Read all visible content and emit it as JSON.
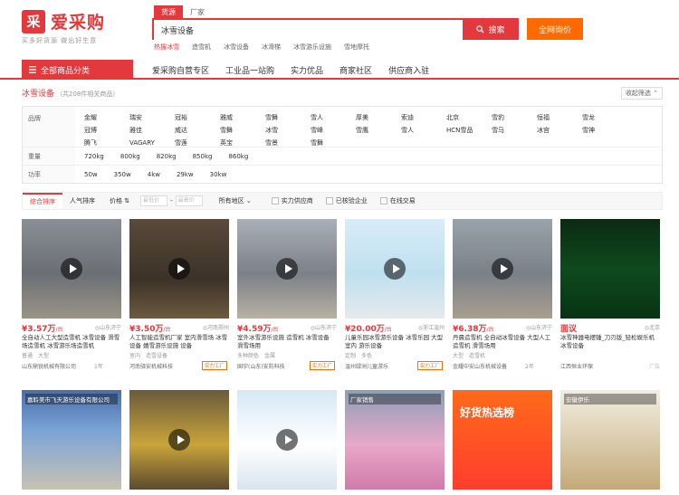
{
  "header": {
    "logo_glyph": "采",
    "logo_text": "爱采购",
    "slogan": "买多好货源  做出好生意",
    "search_tabs": [
      "货源",
      "厂家"
    ],
    "search_value": "冰雪设备",
    "search_button": "搜索",
    "inquiry_button": "全网询价",
    "hot_label": "热搜冰雪",
    "hot_terms": [
      "造雪机",
      "冰雪设备",
      "冰滑梯",
      "冰雪游乐设施",
      "雪地摩托"
    ]
  },
  "nav": {
    "all_categories": "全部商品分类",
    "links": [
      "爱采购自营专区",
      "工业品一站购",
      "实力优品",
      "商家社区",
      "供应商入驻"
    ]
  },
  "breadcrumb": {
    "keyword": "冰雪设备",
    "count_text": "（共208件相关商品）"
  },
  "collapse_label": "收起筛选",
  "filters": {
    "brand_label": "品牌",
    "brands_row1": [
      "金耀",
      "瑞安",
      "冠裕",
      "雅威",
      "雪舞",
      "雪人",
      "厚美",
      "索迪",
      "北京",
      "雪豹"
    ],
    "brands_row2": [
      "恒福",
      "雪龙",
      "冠博",
      "雅佳",
      "威达",
      "雪舞",
      "冰雪",
      "雪峰",
      "雪鹰",
      "雪人"
    ],
    "brands_row3": [
      "HCN雪品",
      "雪马",
      "冰宫",
      "雪神",
      "腾飞",
      "VAGARY",
      "雪莲",
      "英宝",
      "雪景",
      "雪舞"
    ],
    "weight_label": "重量",
    "weights": [
      "720kg",
      "800kg",
      "820kg",
      "850kg",
      "860kg"
    ],
    "power_label": "功率",
    "powers": [
      "50w",
      "350w",
      "4kw",
      "29kw",
      "30kw"
    ]
  },
  "sort": {
    "items": [
      "综合排序",
      "人气排序",
      "价格"
    ],
    "price_from": "最低价",
    "price_to": "最高价",
    "region": "所有地区",
    "checks": [
      "实力供应商",
      "已核验企业",
      "在线交易"
    ]
  },
  "products": [
    {
      "price": "¥3.57万",
      "unit": "/台",
      "loc": "山东济宁",
      "title": "全自动人工大型造雪机 冰雪设备 滑雪场造雪机 冰雪游乐场造雪机",
      "tags": [
        "普通",
        "大型"
      ],
      "company": "山东鼎锐机械有限公司",
      "badge": "",
      "year": "1年"
    },
    {
      "price": "¥3.50万",
      "unit": "/台",
      "loc": "河南郑州",
      "title": "人工智能造雪机厂家 室内滑雪场 冰雪设备 嬉雪游乐设施 设备",
      "tags": [
        "室内",
        "造雪设备"
      ],
      "company": "河南驿安机械科技",
      "badge": "实力工厂",
      "year": ""
    },
    {
      "price": "¥4.59万",
      "unit": "/台",
      "loc": "山东济宁",
      "title": "室外冰雪游乐设施 造雪机 冰雪设备 滑雪场用",
      "tags": [
        "多种颜色",
        "金属"
      ],
      "company": "国宇(山东)安防科技",
      "badge": "实力工厂",
      "year": ""
    },
    {
      "price": "¥20.00万",
      "unit": "/台",
      "loc": "浙江温州",
      "title": "儿童乐园冰雪游乐设备 冰雪乐园 大型室内 游乐设备",
      "tags": [
        "定制",
        "多色"
      ],
      "company": "温州绿洲儿童游乐",
      "badge": "实力工厂",
      "year": ""
    },
    {
      "price": "¥6.38万",
      "unit": "/台",
      "loc": "山东济宁",
      "title": "丹晨造雪机 全自动冰雪设备 大型人工造雪机 滑雪场用",
      "tags": [
        "大型",
        "造雪机"
      ],
      "company": "金耀中安山东机械设备",
      "badge": "",
      "year": "2年"
    },
    {
      "price": "面议",
      "unit": "",
      "loc": "北京",
      "title": "冰雪神器电摆锤_刀刃版_轻松娱乐机 冰雪设备",
      "tags": [],
      "company": "江西恒业环保",
      "badge": "",
      "year": "",
      "ad": "广告"
    }
  ],
  "products_row2": [
    {
      "title": "嘉聆美市飞天游乐设备有限公司"
    },
    {
      "title": ""
    },
    {
      "title": ""
    },
    {
      "title": "厂家销售"
    },
    {
      "title": "好货热选榜"
    },
    {
      "title": "安徽伊乐"
    }
  ]
}
